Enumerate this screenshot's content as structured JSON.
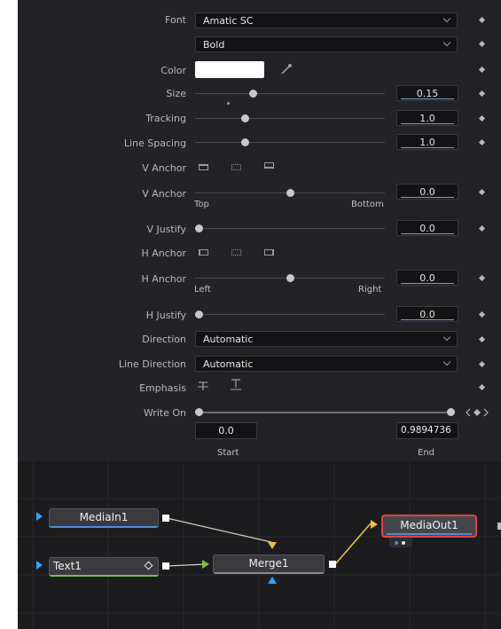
{
  "inspector": {
    "font": {
      "label": "Font",
      "family": "Amatic SC",
      "style": "Bold"
    },
    "color": {
      "label": "Color",
      "swatch": "#ffffff"
    },
    "size": {
      "label": "Size",
      "value": "0.15"
    },
    "tracking": {
      "label": "Tracking",
      "value": "1.0"
    },
    "line_spacing": {
      "label": "Line Spacing",
      "value": "1.0"
    },
    "v_anchor_buttons": {
      "label": "V Anchor"
    },
    "v_anchor": {
      "label": "V Anchor",
      "value": "0.0",
      "min_label": "Top",
      "max_label": "Bottom"
    },
    "v_justify": {
      "label": "V Justify",
      "value": "0.0"
    },
    "h_anchor_buttons": {
      "label": "H Anchor"
    },
    "h_anchor": {
      "label": "H Anchor",
      "value": "0.0",
      "min_label": "Left",
      "max_label": "Right"
    },
    "h_justify": {
      "label": "H Justify",
      "value": "0.0"
    },
    "direction": {
      "label": "Direction",
      "value": "Automatic"
    },
    "line_direction": {
      "label": "Line Direction",
      "value": "Automatic"
    },
    "emphasis": {
      "label": "Emphasis"
    },
    "write_on": {
      "label": "Write On",
      "start_value": "0.0",
      "end_value": "0.9894736",
      "start_label": "Start",
      "end_label": "End"
    }
  },
  "node_graph": {
    "media_in": "MediaIn1",
    "text": "Text1",
    "merge": "Merge1",
    "media_out": "MediaOut1"
  },
  "colors": {
    "selected_node_border": "#e0443c",
    "text_node_underline": "#7ec23a",
    "media_node_underline": "#4a90d9",
    "connection_yellow": "#e8c23a",
    "input_blue": "#29a3ff",
    "input_green": "#7ec23a"
  }
}
